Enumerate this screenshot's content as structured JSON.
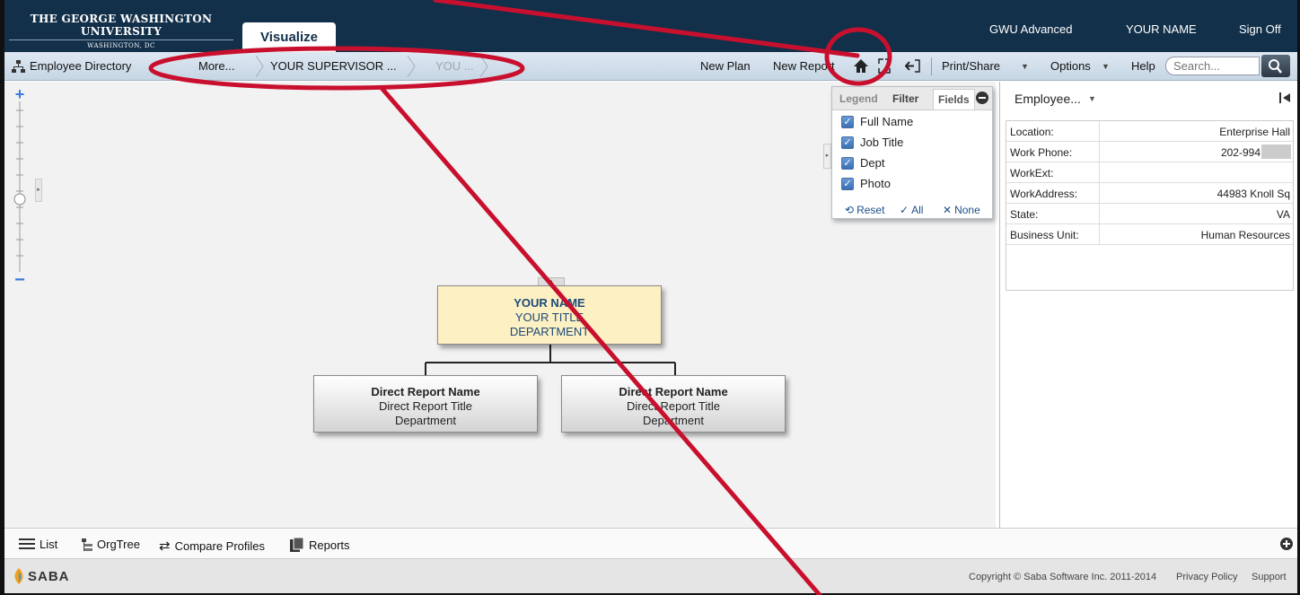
{
  "header": {
    "logo_line1": "THE GEORGE WASHINGTON UNIVERSITY",
    "logo_line2": "WASHINGTON, DC",
    "active_tab": "Visualize",
    "links": [
      "GWU Advanced",
      "YOUR NAME",
      "Sign Off"
    ]
  },
  "toolbar": {
    "directory_label": "Employee Directory",
    "breadcrumbs": [
      "More...",
      "YOUR SUPERVISOR ...",
      "YOU ..."
    ],
    "new_plan": "New Plan",
    "new_report": "New Report",
    "print_share": "Print/Share",
    "options": "Options",
    "help": "Help",
    "search_placeholder": "Search..."
  },
  "fields_panel": {
    "tabs": [
      "Legend",
      "Filter",
      "Fields"
    ],
    "fields": [
      "Full Name",
      "Job Title",
      "Dept",
      "Photo"
    ],
    "reset": "Reset",
    "all": "All",
    "none": "None"
  },
  "org_chart": {
    "root": {
      "name": "YOUR NAME",
      "title": "YOUR TITLE",
      "dept": "DEPARTMENT"
    },
    "reports": [
      {
        "name": "Direct Report Name",
        "title": "Direct Report Title",
        "dept": "Department"
      },
      {
        "name": "Direct Report Name",
        "title": "Direct Report Title",
        "dept": "Department"
      }
    ]
  },
  "right_panel": {
    "selector": "Employee...",
    "rows": [
      {
        "label": "Location:",
        "value": "Enterprise Hall"
      },
      {
        "label": "Work Phone:",
        "value": "202-994"
      },
      {
        "label": "WorkExt:",
        "value": ""
      },
      {
        "label": "WorkAddress:",
        "value": "44983 Knoll Sq"
      },
      {
        "label": "State:",
        "value": "VA"
      },
      {
        "label": "Business Unit:",
        "value": "Human Resources"
      }
    ]
  },
  "bottom_bar": {
    "items": [
      "List",
      "OrgTree",
      "Compare Profiles",
      "Reports"
    ]
  },
  "footer": {
    "brand": "SABA",
    "copyright": "Copyright © Saba Software Inc. 2011-2014",
    "privacy": "Privacy Policy",
    "support": "Support"
  },
  "colors": {
    "header_bg": "#13304a",
    "root_node": "#fdf0c2",
    "annotation": "#c8102e"
  }
}
